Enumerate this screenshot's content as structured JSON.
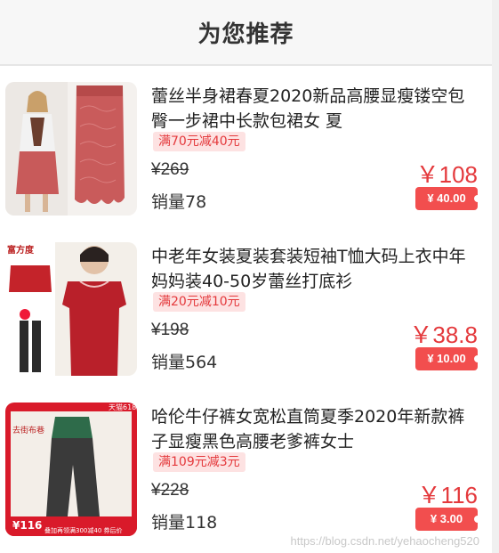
{
  "header": {
    "title": "为您推荐"
  },
  "products": [
    {
      "title": "蕾丝半身裙春夏2020新品高腰显瘦镂空包臀一步裙中长款包裙女 夏",
      "promo": "满70元减40元",
      "original_price": "¥269",
      "price": "￥108",
      "sales": "销量78",
      "coupon": "¥ 40.00"
    },
    {
      "title": "中老年女装夏装套装短袖T恤大码上衣中年妈妈装40-50岁蕾丝打底衫",
      "promo": "满20元减10元",
      "original_price": "¥198",
      "price": "￥38.8",
      "sales": "销量564",
      "coupon": "¥ 10.00",
      "image_text": {
        "brand": "富方度",
        "gift": "送"
      }
    },
    {
      "title": "哈伦牛仔裤女宽松直筒夏季2020年新款裤子显瘦黑色高腰老爹裤女士",
      "promo": "满109元减3元",
      "original_price": "¥228",
      "price": "￥116",
      "sales": "销量118",
      "coupon": "¥ 3.00",
      "image_text": {
        "tag": "天猫618",
        "side": "去街布巷",
        "price": "¥116",
        "banner": "叠加再领满300减40 券后价"
      }
    }
  ],
  "watermark": "https://blog.csdn.net/yehaocheng520",
  "colors": {
    "price_red": "#e4393c",
    "coupon_red": "#f24e4e",
    "promo_bg": "#fde2e2"
  }
}
